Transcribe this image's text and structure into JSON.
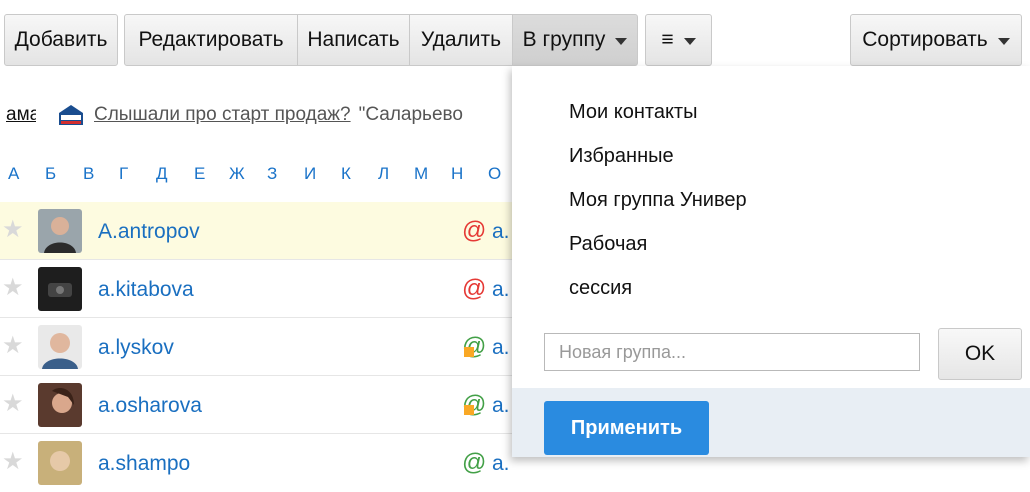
{
  "toolbar": {
    "add_label": "Добавить",
    "edit_label": "Редактировать",
    "write_label": "Написать",
    "delete_label": "Удалить",
    "to_group_label": "В группу",
    "menu_label": "≡",
    "sort_label": "Сортировать"
  },
  "ad": {
    "left_fragment": "ама",
    "link_text": "Слышали про старт продаж?",
    "rest_text": "\"Саларьево"
  },
  "alphabet": [
    "А",
    "Б",
    "В",
    "Г",
    "Д",
    "Е",
    "Ж",
    "З",
    "И",
    "К",
    "Л",
    "М",
    "Н",
    "О"
  ],
  "contacts": [
    {
      "name": "A.antropov",
      "email": "a.",
      "status": "red",
      "highlighted": true
    },
    {
      "name": "a.kitabova",
      "email": "a.",
      "status": "red",
      "highlighted": false
    },
    {
      "name": "a.lyskov",
      "email": "a.",
      "status": "green",
      "highlighted": false
    },
    {
      "name": "a.osharova",
      "email": "a.",
      "status": "green",
      "highlighted": false
    },
    {
      "name": "a.shampo",
      "email": "a.",
      "status": "green",
      "highlighted": false
    }
  ],
  "dropdown": {
    "groups": [
      "Мои контакты",
      "Избранные",
      "Моя группа Универ",
      "Рабочая",
      "сессия"
    ],
    "new_group_placeholder": "Новая группа...",
    "ok_label": "OK",
    "apply_label": "Применить"
  },
  "colors": {
    "link": "#1a6fc0",
    "apply_button": "#2a8be0",
    "highlight_row": "#fdfbe0",
    "status_red": "#e53935",
    "status_green": "#43a047"
  }
}
